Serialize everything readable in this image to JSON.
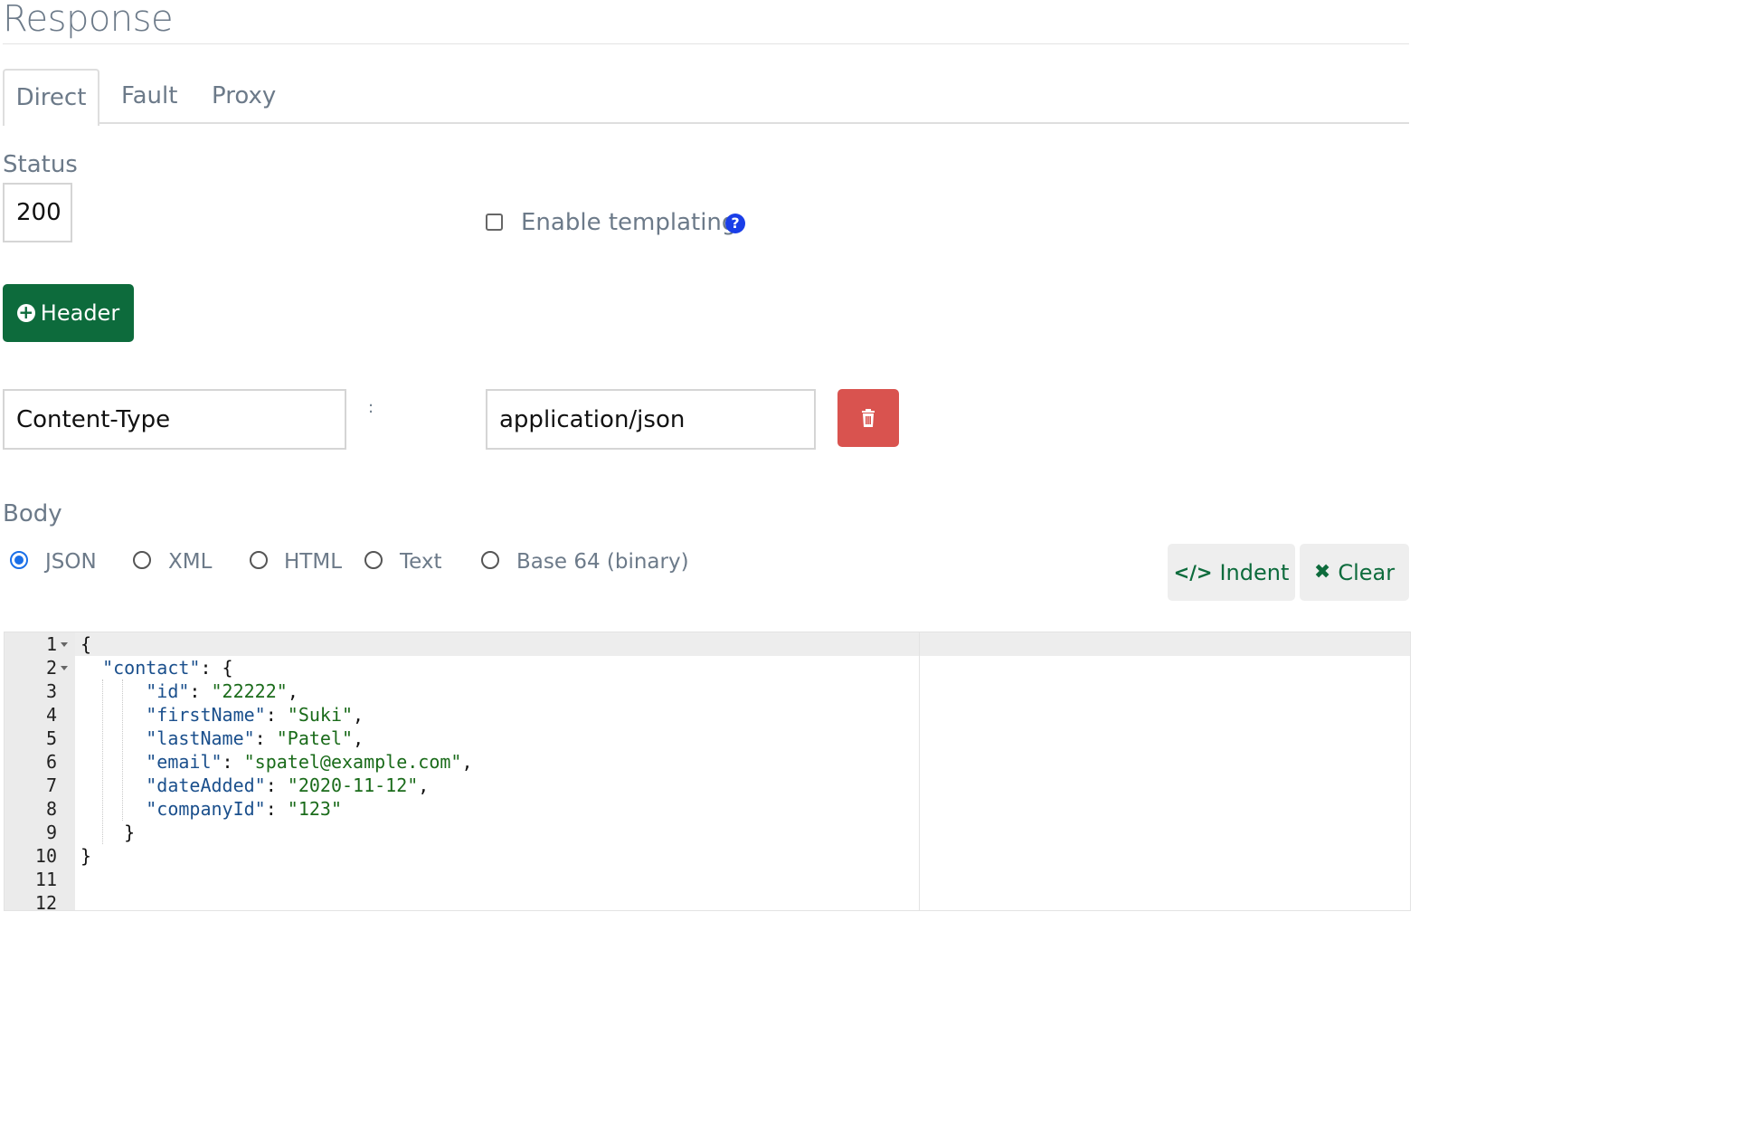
{
  "page": {
    "title": "Response"
  },
  "tabs": [
    {
      "label": "Direct",
      "active": true
    },
    {
      "label": "Fault",
      "active": false
    },
    {
      "label": "Proxy",
      "active": false
    }
  ],
  "status": {
    "label": "Status",
    "value": "200"
  },
  "templating": {
    "label": "Enable templating",
    "checked": false,
    "help_icon": "question-circle-icon"
  },
  "add_header_button": {
    "label": "Header",
    "icon": "plus-circle-icon"
  },
  "header_row": {
    "name": "Content-Type",
    "separator": ":",
    "value": "application/json",
    "delete_icon": "trash-icon"
  },
  "body": {
    "label": "Body",
    "formats": [
      {
        "label": "JSON",
        "checked": true
      },
      {
        "label": "XML",
        "checked": false
      },
      {
        "label": "HTML",
        "checked": false
      },
      {
        "label": "Text",
        "checked": false
      },
      {
        "label": "Base 64 (binary)",
        "checked": false
      }
    ],
    "indent_button": {
      "label": "Indent",
      "icon": "code-icon"
    },
    "clear_button": {
      "label": "Clear",
      "icon": "times-icon"
    }
  },
  "editor": {
    "line_numbers": [
      "1",
      "2",
      "3",
      "4",
      "5",
      "6",
      "7",
      "8",
      "9",
      "10",
      "11",
      "12"
    ],
    "lines": [
      {
        "text": "{"
      },
      {
        "key": "\"contact\"",
        "rest": ": {"
      },
      {
        "key": "\"id\"",
        "colon": ": ",
        "val": "\"22222\"",
        "tail": ","
      },
      {
        "key": "\"firstName\"",
        "colon": ": ",
        "val": "\"Suki\"",
        "tail": ","
      },
      {
        "key": "\"lastName\"",
        "colon": ": ",
        "val": "\"Patel\"",
        "tail": ","
      },
      {
        "key": "\"email\"",
        "colon": ": ",
        "val": "\"spatel@example.com\"",
        "tail": ","
      },
      {
        "key": "\"dateAdded\"",
        "colon": ": ",
        "val": "\"2020-11-12\"",
        "tail": ","
      },
      {
        "key": "\"companyId\"",
        "colon": ": ",
        "val": "\"123\"",
        "tail": ""
      },
      {
        "text": "}"
      },
      {
        "text": "}"
      },
      {
        "text": ""
      },
      {
        "text": ""
      }
    ]
  }
}
